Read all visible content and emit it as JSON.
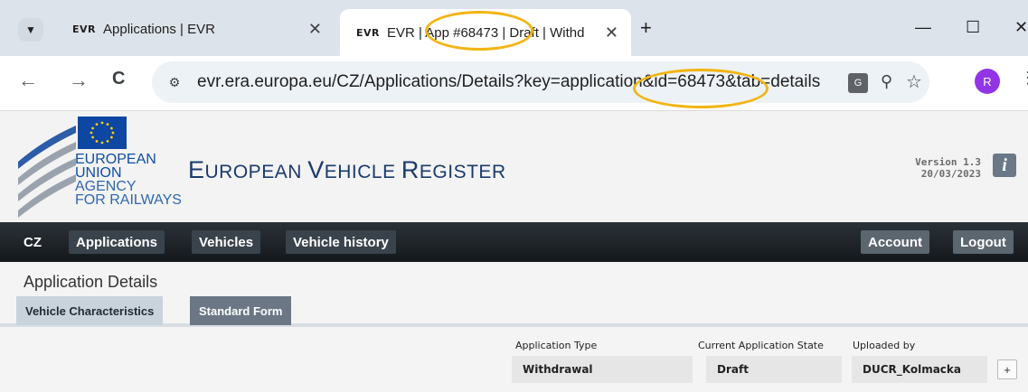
{
  "browser": {
    "tab_menu_icon": "chevron-down-icon",
    "tabs": [
      {
        "favicon": "EVR",
        "title": "Applications | EVR",
        "close": "✕"
      },
      {
        "favicon": "EVR",
        "title": "EVR | App #68473 | Draft | Withd",
        "close": "✕"
      }
    ],
    "new_tab": "+",
    "window_controls": {
      "minimize": "—",
      "maximize": "☐",
      "close": "✕"
    },
    "nav": {
      "back": "←",
      "forward": "→",
      "reload": "C"
    },
    "url": "evr.era.europa.eu/CZ/Applications/Details?key=application&id=68473&tab=details",
    "site_info_icon": "tune-icon",
    "translate_label": "G",
    "zoom_icon": "zoom-icon",
    "star_icon": "star-icon",
    "profile_initial": "R",
    "menu_icon": "kebab-icon"
  },
  "site": {
    "logo_text": [
      "EUROPEAN",
      "UNION",
      "AGENCY",
      "FOR RAILWAYS"
    ],
    "title_parts": [
      {
        "cap": "E",
        "rest": "UROPEAN "
      },
      {
        "cap": "V",
        "rest": "EHICLE "
      },
      {
        "cap": "R",
        "rest": "EGISTER"
      }
    ],
    "version": "Version 1.3",
    "version_date": "20/03/2023",
    "info_label": "i"
  },
  "navbar": {
    "country": "CZ",
    "items": [
      "Applications",
      "Vehicles",
      "Vehicle history"
    ],
    "account": "Account",
    "logout": "Logout"
  },
  "details": {
    "title": "Application Details",
    "tabs": [
      "Vehicle Characteristics",
      "Standard Form"
    ],
    "fields": [
      {
        "label": "Application Type",
        "value": "Withdrawal"
      },
      {
        "label": "Current Application State",
        "value": "Draft"
      },
      {
        "label": "Uploaded by",
        "value": "DUCR_Kolmacka"
      }
    ],
    "plus_label": "+"
  },
  "colors": {
    "annotation": "#f2b512",
    "navbar": "#1b2025",
    "header_text": "#1a3a6e"
  }
}
